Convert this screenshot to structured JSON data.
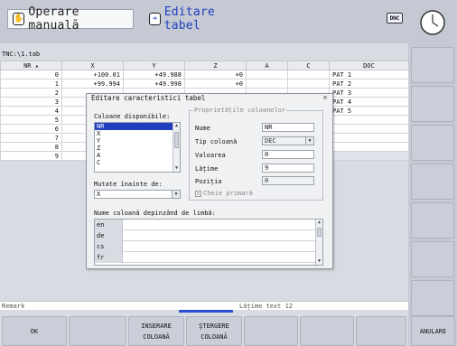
{
  "header": {
    "mode_manual": "Operare manuală",
    "mode_edit": "Editare tabel",
    "dnc": "DNC"
  },
  "path": "TNC:\\1.tab",
  "table": {
    "columns": [
      "NR",
      "X",
      "Y",
      "Z",
      "A",
      "C",
      "DOC"
    ],
    "rows": [
      [
        "0",
        "+100.01",
        "+49.988",
        "+0",
        "",
        "",
        "PAT 1"
      ],
      [
        "1",
        "+99.994",
        "+49.998",
        "+0",
        "",
        "",
        "PAT 2"
      ],
      [
        "2",
        "",
        "",
        "",
        "",
        "",
        "PAT 3"
      ],
      [
        "3",
        "",
        "",
        "",
        "",
        "",
        "PAT 4"
      ],
      [
        "4",
        "",
        "",
        "",
        "",
        "",
        "PAT 5"
      ],
      [
        "5",
        "",
        "",
        "",
        "",
        "",
        ""
      ],
      [
        "6",
        "",
        "",
        "",
        "",
        "",
        ""
      ],
      [
        "7",
        "",
        "",
        "",
        "",
        "",
        ""
      ],
      [
        "8",
        "",
        "",
        "",
        "",
        "",
        ""
      ],
      [
        "9",
        "",
        "",
        "",
        "",
        "",
        ""
      ]
    ]
  },
  "dialog": {
    "title": "Editare caracteristici tabel",
    "close": "⊠",
    "available_label": "Coloane disponibile:",
    "available_items": [
      "NR",
      "X",
      "Y",
      "Z",
      "A",
      "C"
    ],
    "selected_item": "NR",
    "move_before_label": "Mutate înainte de:",
    "move_before_value": "X",
    "props_title": "Proprietățile coloanelor",
    "props": {
      "name_label": "Nume",
      "name_value": "NR",
      "type_label": "Tip coloană",
      "type_value": "DEC",
      "value_label": "Valoarea",
      "value_value": "0",
      "width_label": "Lățime",
      "width_value": "9",
      "pos_label": "Poziția",
      "pos_value": "0"
    },
    "primary_key_label": "Cheie primară",
    "lang_label": "Nume coloană depinzând de limbă:",
    "lang_rows": [
      "en",
      "de",
      "cs",
      "fr"
    ]
  },
  "status": {
    "remark": "Remark",
    "width_text": "Lățime text 12"
  },
  "softkeys": {
    "ok": "OK",
    "insert_1": "INSERARE",
    "insert_2": "COLOANĂ",
    "delete_1": "ŞTERGERE",
    "delete_2": "COLOANĂ",
    "cancel": "ANULARE"
  },
  "icons": [
    "hand-icon",
    "edit-arrow-icon",
    "clock-icon"
  ]
}
